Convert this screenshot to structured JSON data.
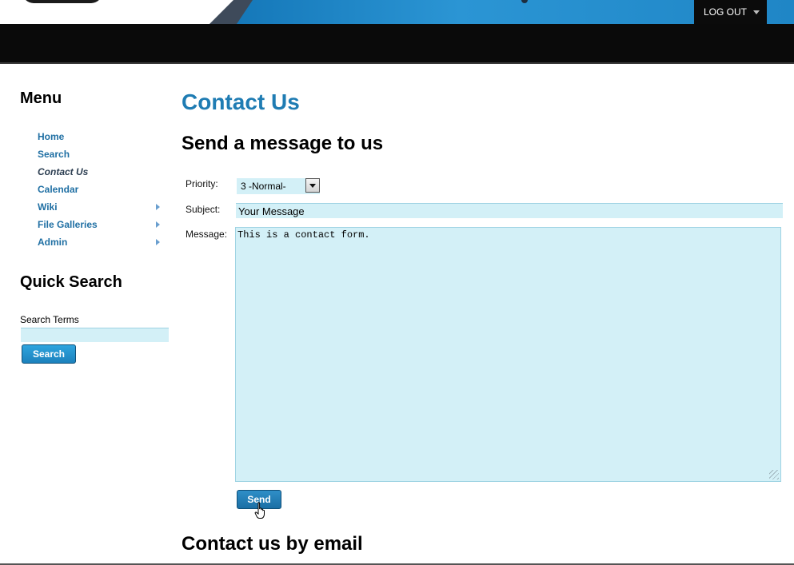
{
  "header": {
    "logout_label": "LOG OUT"
  },
  "sidebar": {
    "menu_title": "Menu",
    "menu_items": [
      {
        "label": "Home",
        "has_submenu": false,
        "current": false
      },
      {
        "label": "Search",
        "has_submenu": false,
        "current": false
      },
      {
        "label": "Contact Us",
        "has_submenu": false,
        "current": true
      },
      {
        "label": "Calendar",
        "has_submenu": false,
        "current": false
      },
      {
        "label": "Wiki",
        "has_submenu": true,
        "current": false
      },
      {
        "label": "File Galleries",
        "has_submenu": true,
        "current": false
      },
      {
        "label": "Admin",
        "has_submenu": true,
        "current": false
      }
    ],
    "quick_search": {
      "title": "Quick Search",
      "field_label": "Search Terms",
      "value": "",
      "button_label": "Search"
    }
  },
  "main": {
    "page_title": "Contact Us",
    "form_heading": "Send a message to us",
    "form": {
      "priority_label": "Priority:",
      "priority_value": "3 -Normal-",
      "subject_label": "Subject:",
      "subject_value": "Your Message",
      "message_label": "Message:",
      "message_value": "This is a contact form.",
      "send_label": "Send"
    },
    "email_heading": "Contact us by email"
  },
  "colors": {
    "link": "#1f6fa3",
    "title": "#1f7cb3",
    "field_bg": "#d3f0f7",
    "button": "#1c82bd",
    "header_blue": "#1f86c6",
    "navbar": "#0a0a0a"
  }
}
